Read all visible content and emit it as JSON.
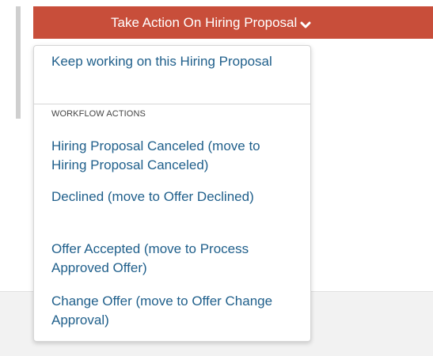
{
  "button": {
    "label": "Take Action On Hiring Proposal"
  },
  "icons": {
    "chevron": "chevron-down-icon"
  },
  "colors": {
    "button_bg": "#c84e3a",
    "link_text": "#1f5f8b"
  },
  "menu": {
    "keep_working": "Keep working on this Hiring Proposal",
    "section_label": "WORKFLOW ACTIONS",
    "actions": [
      "Hiring Proposal Canceled (move to Hiring Proposal Canceled)",
      "Declined (move to Offer Declined)",
      "Offer Accepted (move to Process Approved Offer)",
      "Change Offer (move to Offer Change Approval)"
    ]
  }
}
